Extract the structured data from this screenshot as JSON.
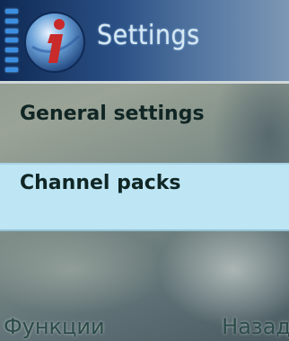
{
  "header": {
    "title": "Settings",
    "app_icon": "info-i-icon",
    "signal_icon": "signal-strength-icon"
  },
  "menu": {
    "items": [
      {
        "label": "General settings",
        "selected": false
      },
      {
        "label": "Channel packs",
        "selected": true
      }
    ]
  },
  "softkeys": {
    "left": "Функции",
    "right": "Назад"
  },
  "colors": {
    "title_bar": "#1f3f70",
    "selection_highlight": "#bde5f4",
    "text_dark": "#102624",
    "title_text": "#d6e8f2"
  }
}
